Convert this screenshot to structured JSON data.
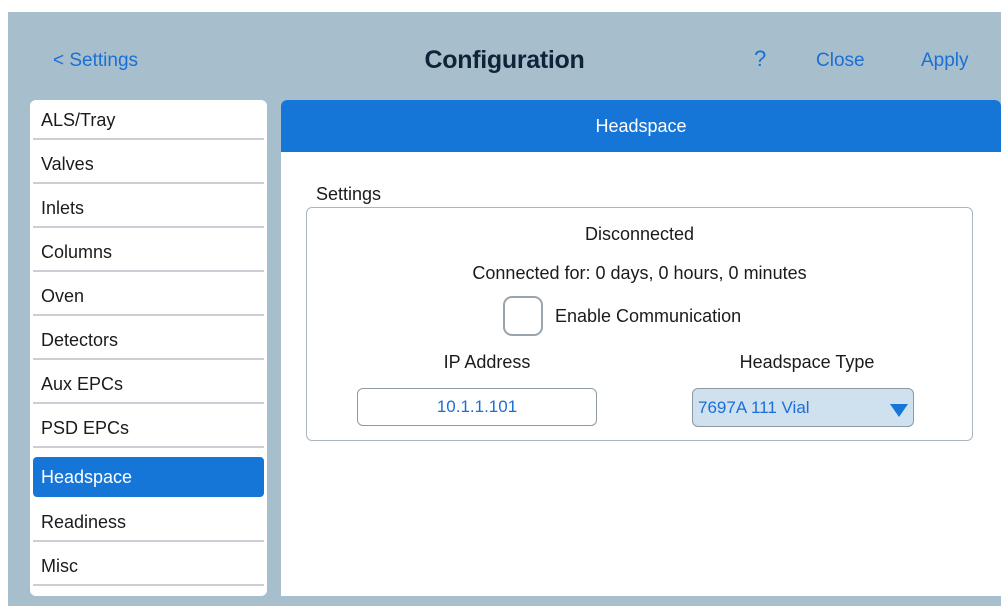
{
  "header": {
    "back_label": "< Settings",
    "title": "Configuration",
    "help_label": "?",
    "close_label": "Close",
    "apply_label": "Apply"
  },
  "sidebar": {
    "items": [
      {
        "label": "ALS/Tray"
      },
      {
        "label": "Valves"
      },
      {
        "label": "Inlets"
      },
      {
        "label": "Columns"
      },
      {
        "label": "Oven"
      },
      {
        "label": "Detectors"
      },
      {
        "label": "Aux EPCs"
      },
      {
        "label": "PSD EPCs"
      },
      {
        "label": "Headspace",
        "active": true
      },
      {
        "label": "Readiness"
      },
      {
        "label": "Misc"
      }
    ]
  },
  "panel": {
    "title": "Headspace",
    "section_label": "Settings",
    "status": "Disconnected",
    "connected_for": "Connected for: 0 days, 0 hours, 0 minutes",
    "enable_communication": {
      "label": "Enable Communication",
      "checked": false
    },
    "ip_address": {
      "label": "IP Address",
      "value": "10.1.1.101"
    },
    "headspace_type": {
      "label": "Headspace Type",
      "selected": "7697A 111 Vial"
    }
  },
  "colors": {
    "accent": "#1676d8",
    "link": "#1a6fd6",
    "app_background": "#a7bfcd",
    "dropdown_background": "#cfe0ef"
  }
}
